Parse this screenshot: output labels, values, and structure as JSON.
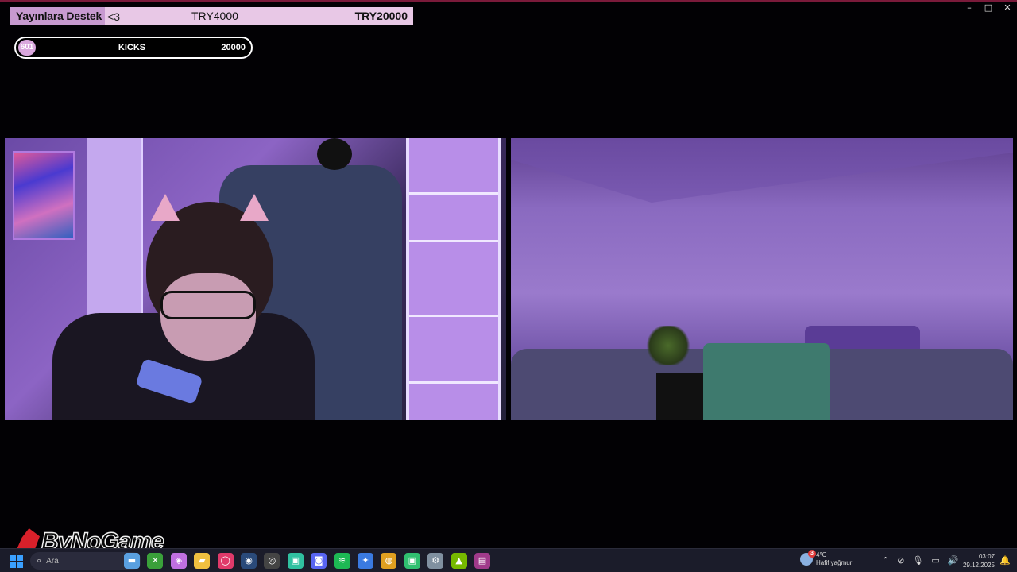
{
  "window_controls": [
    "–",
    "□",
    "✕"
  ],
  "goal": {
    "title": "Yayınlara Destek",
    "heart": "<3",
    "current": "TRY4000",
    "target": "TRY20000",
    "progress": 0.2
  },
  "kicks": {
    "count": "601",
    "label": "KICKS",
    "target": "20000"
  },
  "watermark": {
    "text": "ByNoGame"
  },
  "taskbar": {
    "search_placeholder": "Ara",
    "search_icon": "⌕",
    "apps": [
      {
        "name": "photos-icon",
        "glyph": "▬",
        "color": "#5aa0e0"
      },
      {
        "name": "xbox-icon",
        "glyph": "✕",
        "color": "#3aa03a"
      },
      {
        "name": "copilot-icon",
        "glyph": "◈",
        "color": "#c070e0"
      },
      {
        "name": "file-explorer-icon",
        "glyph": "▰",
        "color": "#f0c040"
      },
      {
        "name": "opera-icon",
        "glyph": "◯",
        "color": "#e03a6a"
      },
      {
        "name": "steam-icon",
        "glyph": "◉",
        "color": "#2a4a7a"
      },
      {
        "name": "obs-icon",
        "glyph": "◎",
        "color": "#444"
      },
      {
        "name": "app-icon",
        "glyph": "▣",
        "color": "#30c0a0"
      },
      {
        "name": "discord-icon",
        "glyph": "◙",
        "color": "#5865f2"
      },
      {
        "name": "spotify-icon",
        "glyph": "≋",
        "color": "#1db954"
      },
      {
        "name": "network-icon",
        "glyph": "✦",
        "color": "#3a7ae0"
      },
      {
        "name": "chrome-icon",
        "glyph": "◍",
        "color": "#e0a020"
      },
      {
        "name": "kick-icon",
        "glyph": "▣",
        "color": "#30c070"
      },
      {
        "name": "settings-icon",
        "glyph": "⚙",
        "color": "#8090a0"
      },
      {
        "name": "nvidia-icon",
        "glyph": "▲",
        "color": "#76b900"
      },
      {
        "name": "winrar-icon",
        "glyph": "▤",
        "color": "#a03a8a"
      }
    ],
    "weather": {
      "badge": "3",
      "temp": "4°C",
      "desc": "Hafif yağmur"
    },
    "tray_icons": [
      "⌃",
      "⊘",
      "🎙",
      "▭",
      "🔊"
    ],
    "time": "03:07",
    "date": "29.12.2025",
    "notification_icon": "🔔"
  }
}
